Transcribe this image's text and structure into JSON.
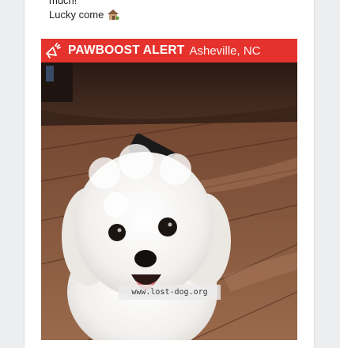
{
  "post": {
    "line1": "much!",
    "line2": "Lucky come"
  },
  "alert": {
    "title": "PAWBOOST ALERT",
    "location": "Asheville, NC",
    "bar_color": "#e5322d"
  },
  "photo": {
    "watermark": "www.lost-dog.org"
  },
  "icons": {
    "house": "house-icon",
    "megaphone": "megaphone-icon"
  }
}
